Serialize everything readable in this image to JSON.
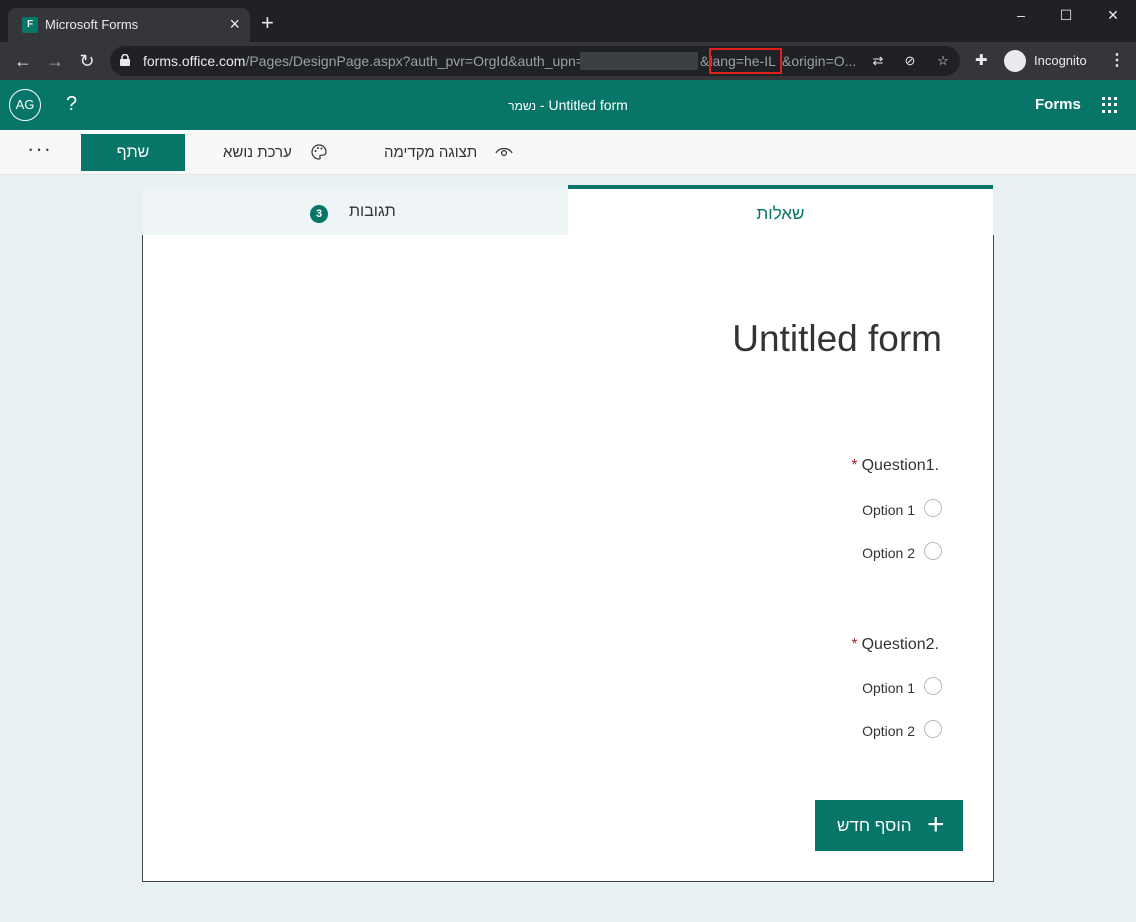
{
  "browser": {
    "tab_title": "Microsoft Forms",
    "favicon_text": "F",
    "url_host": "forms.office.com",
    "url_path_before": "/Pages/DesignPage.aspx?auth_pvr=OrgId&auth_upn=",
    "url_lang": "&lang=he-IL",
    "url_after": "&origin=O...",
    "incognito_label": "Incognito"
  },
  "header": {
    "avatar_initials": "AG",
    "help_label": "?",
    "doc_title": "Untitled form",
    "saved_status": "נשמר",
    "brand": "Forms"
  },
  "commandbar": {
    "more_label": "···",
    "share_label": "שתף",
    "theme_label": "ערכת נושא",
    "preview_label": "תצוגה מקדימה"
  },
  "tabs": {
    "questions_label": "שאלות",
    "responses_label": "תגובות",
    "responses_count": "3"
  },
  "form": {
    "title": "Untitled form",
    "questions": [
      {
        "number": "1.",
        "title": "Question",
        "options": [
          "Option 1",
          "Option 2"
        ]
      },
      {
        "number": "2.",
        "title": "Question",
        "options": [
          "Option 1",
          "Option 2"
        ]
      }
    ],
    "add_new_label": "הוסף חדש"
  },
  "colors": {
    "accent": "#077568",
    "required": "#a4262c",
    "highlight_box": "#e0201b"
  }
}
